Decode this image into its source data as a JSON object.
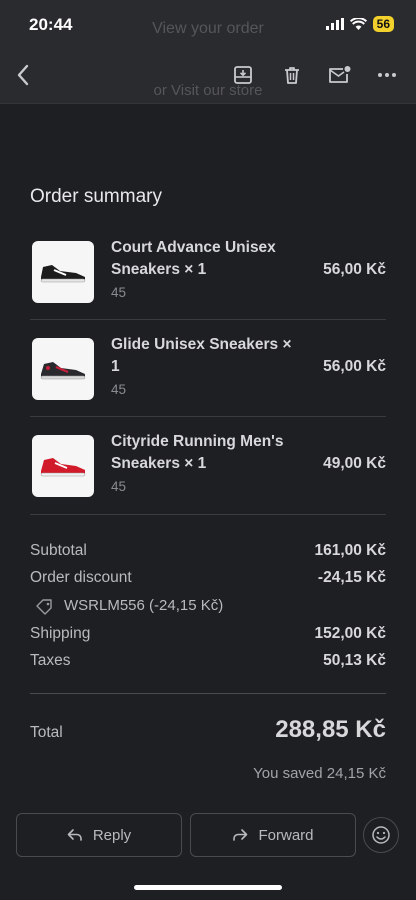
{
  "status_bar": {
    "time": "20:44",
    "battery": "56"
  },
  "ghost_behind": {
    "top_text": "View your order",
    "bottom_text": "or Visit our store"
  },
  "toolbar": {
    "back_icon": "chevron-left-icon",
    "archive_icon": "archive-icon",
    "trash_icon": "trash-icon",
    "mark_unread_icon": "mail-unread-icon",
    "more_icon": "more-icon"
  },
  "order": {
    "title": "Order summary",
    "items": [
      {
        "name": "Court Advance Unisex Sneakers × 1",
        "variant": "45",
        "price": "56,00 Kč",
        "shoe_color": "#1c1c1c",
        "accent": "#ffffff"
      },
      {
        "name": "Glide Unisex Sneakers × 1",
        "variant": "45",
        "price": "56,00 Kč",
        "shoe_color": "#2a2a2e",
        "accent": "#c8203a"
      },
      {
        "name": "Cityride Running Men's Sneakers × 1",
        "variant": "45",
        "price": "49,00 Kč",
        "shoe_color": "#d11a2a",
        "accent": "#ffffff"
      }
    ]
  },
  "summary": {
    "subtotal_label": "Subtotal",
    "subtotal_value": "161,00 Kč",
    "discount_label": "Order discount",
    "discount_value": "-24,15 Kč",
    "discount_code": "WSRLM556 (-24,15 Kč)",
    "shipping_label": "Shipping",
    "shipping_value": "152,00 Kč",
    "taxes_label": "Taxes",
    "taxes_value": "50,13 Kč",
    "total_label": "Total",
    "total_value": "288,85 Kč",
    "saved_text": "You saved 24,15 Kč"
  },
  "actions": {
    "reply_label": "Reply",
    "forward_label": "Forward"
  }
}
